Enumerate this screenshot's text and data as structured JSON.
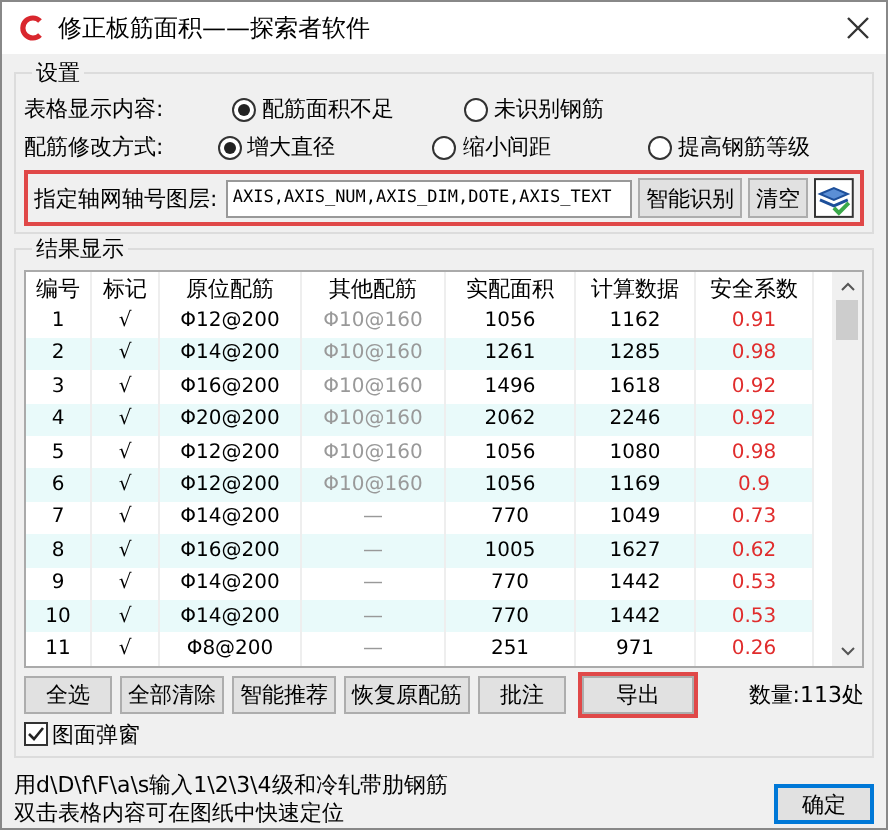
{
  "window": {
    "title": "修正板筋面积——探索者软件"
  },
  "settings": {
    "title": "设置",
    "rows": [
      {
        "label": "表格显示内容:",
        "options": [
          {
            "label": "配筋面积不足",
            "selected": true
          },
          {
            "label": "未识别钢筋",
            "selected": false
          }
        ]
      },
      {
        "label": "配筋修改方式:",
        "options": [
          {
            "label": "增大直径",
            "selected": true
          },
          {
            "label": "缩小间距",
            "selected": false
          },
          {
            "label": "提高钢筋等级",
            "selected": false
          }
        ]
      }
    ],
    "layer": {
      "label": "指定轴网轴号图层:",
      "value": "AXIS,AXIS_NUM,AXIS_DIM,DOTE,AXIS_TEXT",
      "buttons": [
        "智能识别",
        "清空"
      ],
      "highlighted": true
    }
  },
  "results": {
    "title": "结果显示",
    "columns": [
      "编号",
      "标记",
      "原位配筋",
      "其他配筋",
      "实配面积",
      "计算数据",
      "安全系数"
    ],
    "rows": [
      [
        "1",
        "√",
        "Φ12@200",
        "Φ10@160",
        "1056",
        "1162",
        "0.91"
      ],
      [
        "2",
        "√",
        "Φ14@200",
        "Φ10@160",
        "1261",
        "1285",
        "0.98"
      ],
      [
        "3",
        "√",
        "Φ16@200",
        "Φ10@160",
        "1496",
        "1618",
        "0.92"
      ],
      [
        "4",
        "√",
        "Φ20@200",
        "Φ10@160",
        "2062",
        "2246",
        "0.92"
      ],
      [
        "5",
        "√",
        "Φ12@200",
        "Φ10@160",
        "1056",
        "1080",
        "0.98"
      ],
      [
        "6",
        "√",
        "Φ12@200",
        "Φ10@160",
        "1056",
        "1169",
        "0.9"
      ],
      [
        "7",
        "√",
        "Φ14@200",
        "—",
        "770",
        "1049",
        "0.73"
      ],
      [
        "8",
        "√",
        "Φ16@200",
        "—",
        "1005",
        "1627",
        "0.62"
      ],
      [
        "9",
        "√",
        "Φ14@200",
        "—",
        "770",
        "1442",
        "0.53"
      ],
      [
        "10",
        "√",
        "Φ14@200",
        "—",
        "770",
        "1442",
        "0.53"
      ],
      [
        "11",
        "√",
        "Φ8@200",
        "—",
        "251",
        "971",
        "0.26"
      ]
    ],
    "buttons": [
      {
        "label": "全选",
        "highlighted": false
      },
      {
        "label": "全部清除",
        "highlighted": false
      },
      {
        "label": "智能推荐",
        "highlighted": false
      },
      {
        "label": "恢复原配筋",
        "highlighted": false
      },
      {
        "label": "批注",
        "highlighted": false
      },
      {
        "label": "导出",
        "highlighted": true
      }
    ],
    "count": "数量:113处",
    "popup": {
      "label": "图面弹窗",
      "checked": true
    }
  },
  "hints": [
    "用d\\D\\f\\F\\a\\s输入1\\2\\3\\4级和冷轧带肋钢筋",
    "双击表格内容可在图纸中快速定位"
  ],
  "ok_button": "确定"
}
